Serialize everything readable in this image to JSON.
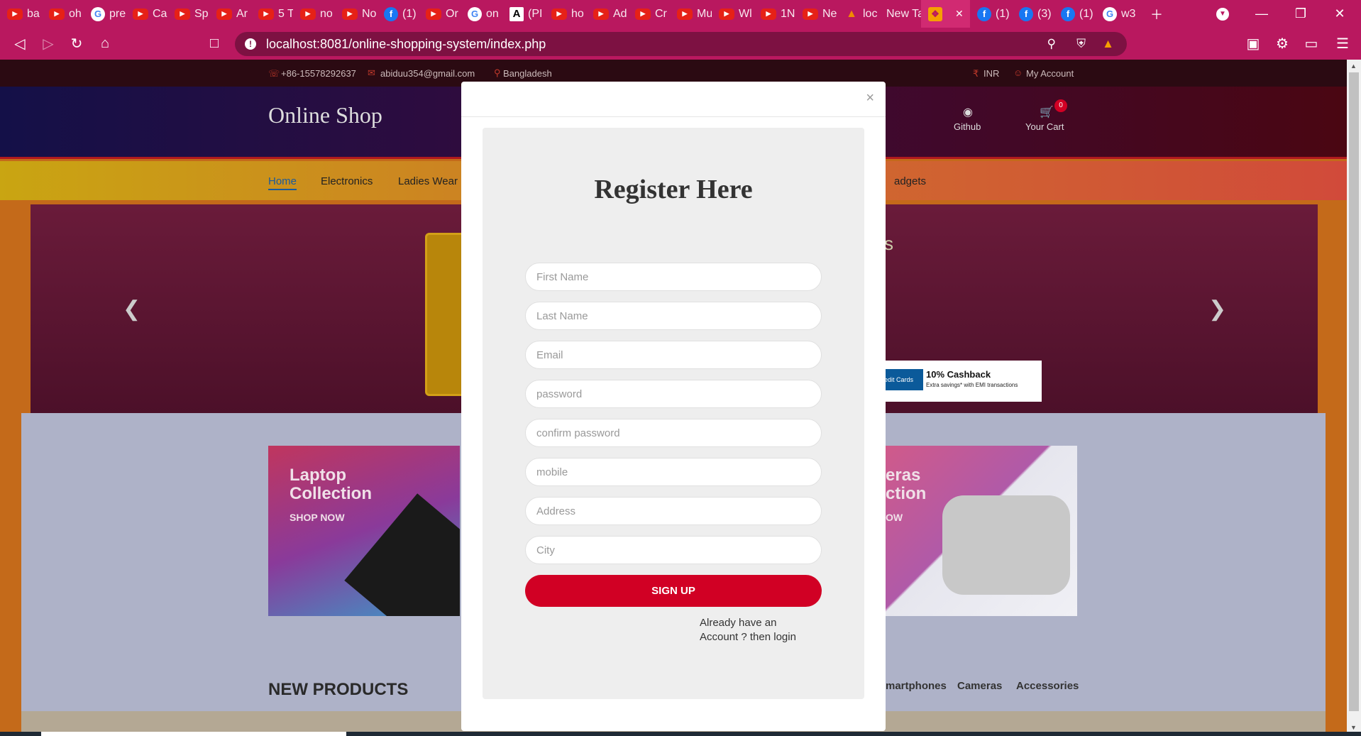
{
  "browser": {
    "tabs": [
      {
        "icon": "youtube",
        "label": "ba"
      },
      {
        "icon": "youtube",
        "label": "oh"
      },
      {
        "icon": "google",
        "label": "pre"
      },
      {
        "icon": "youtube",
        "label": "Ca"
      },
      {
        "icon": "youtube",
        "label": "Sp"
      },
      {
        "icon": "youtube",
        "label": "Ar"
      },
      {
        "icon": "youtube",
        "label": "5 T"
      },
      {
        "icon": "youtube",
        "label": "no"
      },
      {
        "icon": "youtube",
        "label": "No"
      },
      {
        "icon": "facebook",
        "label": "(1)"
      },
      {
        "icon": "youtube",
        "label": "Or"
      },
      {
        "icon": "google",
        "label": "on"
      },
      {
        "icon": "a-doc",
        "label": "(PI"
      },
      {
        "icon": "youtube",
        "label": "ho"
      },
      {
        "icon": "youtube",
        "label": "Ad"
      },
      {
        "icon": "youtube",
        "label": "Cr"
      },
      {
        "icon": "youtube",
        "label": "Mu"
      },
      {
        "icon": "youtube",
        "label": "Wl"
      },
      {
        "icon": "youtube",
        "label": "1N"
      },
      {
        "icon": "youtube",
        "label": "Ne"
      },
      {
        "icon": "vlc",
        "label": "loc"
      },
      {
        "icon": "none",
        "label": "New Ta"
      },
      {
        "icon": "xampp",
        "label": "",
        "active": true
      },
      {
        "icon": "facebook",
        "label": "(1)"
      },
      {
        "icon": "facebook",
        "label": "(3)"
      },
      {
        "icon": "facebook",
        "label": "(1)"
      },
      {
        "icon": "google",
        "label": "w3"
      }
    ],
    "url": "localhost:8081/online-shopping-system/index.php",
    "accent": "#b9185f"
  },
  "site": {
    "phone": "+86-15578292637",
    "email": "abiduu354@gmail.com",
    "location": "Bangladesh",
    "currency": "INR",
    "account": "My Account",
    "logo": "Online Shop",
    "github": "Github",
    "cart": "Your Cart",
    "cart_count": "0",
    "nav": [
      "Home",
      "Electronics",
      "Ladies Wear",
      "adgets"
    ],
    "slide_text": "s",
    "cashback_title": "10% Cashback",
    "cashback_sub": "Extra savings* with EMI transactions",
    "cashback_card": "redit Cards",
    "collection_left_1": "Laptop",
    "collection_left_2": "Collection",
    "shop_now": "SHOP NOW",
    "collection_right_1": "eras",
    "collection_right_2": "ction",
    "shop_now_right": "OW",
    "new_products": "NEW PRODUCTS",
    "product_tabs": [
      "martphones",
      "Cameras",
      "Accessories"
    ]
  },
  "modal": {
    "title": "Register Here",
    "close": "×",
    "placeholders": {
      "first_name": "First Name",
      "last_name": "Last Name",
      "email": "Email",
      "password": "password",
      "confirm_password": "confirm password",
      "mobile": "mobile",
      "address": "Address",
      "city": "City"
    },
    "signup": "SIGN UP",
    "login_line1": "Already have an",
    "login_line2": "Account ? then login"
  }
}
